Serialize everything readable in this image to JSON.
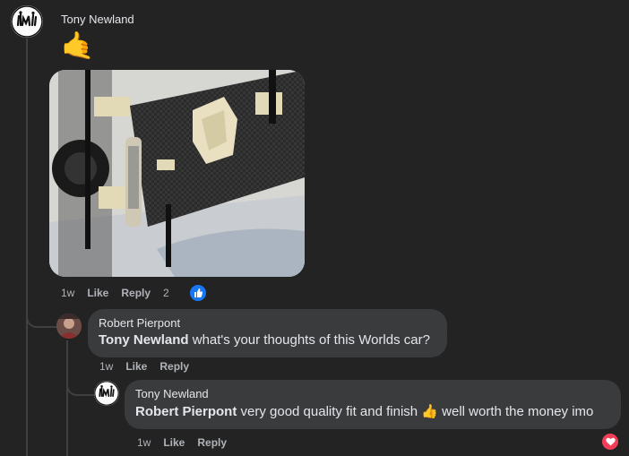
{
  "comment1": {
    "author": "Tony Newland",
    "emoji": "🤙",
    "time": "1w",
    "like_label": "Like",
    "reply_label": "Reply",
    "reaction_count": "2",
    "reaction_type": "like-icon"
  },
  "reply1": {
    "author": "Robert Pierpont",
    "mention": "Tony Newland",
    "text": " what's your thoughts of this Worlds car?",
    "time": "1w",
    "like_label": "Like",
    "reply_label": "Reply"
  },
  "reply2": {
    "author": "Tony Newland",
    "mention": "Robert Pierpont",
    "text_before": " very good quality fit and finish ",
    "emoji": "👍",
    "text_after": " well worth the money imo",
    "time": "1w",
    "like_label": "Like",
    "reply_label": "Reply",
    "reaction_type": "heart-icon"
  },
  "colors": {
    "background": "#232324",
    "bubble": "#3a3b3c",
    "like_blue": "#1877f2",
    "heart_red": "#f33e58"
  }
}
